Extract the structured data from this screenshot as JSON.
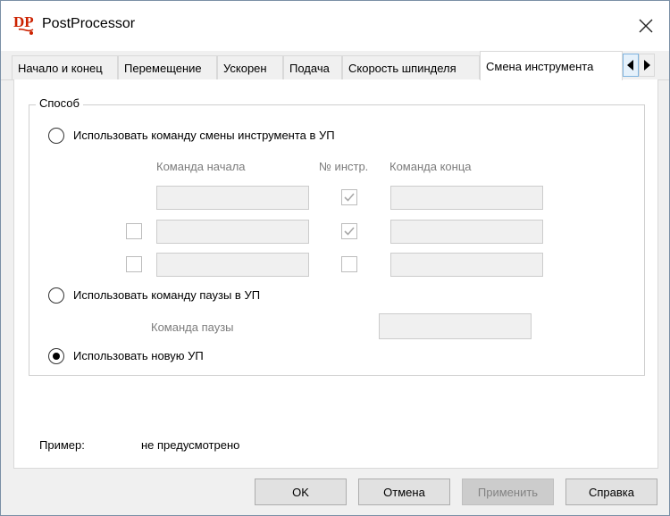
{
  "window": {
    "title": "PostProcessor"
  },
  "tabs": [
    {
      "label": "Начало и конец"
    },
    {
      "label": "Перемещение"
    },
    {
      "label": "Ускорен"
    },
    {
      "label": "Подача"
    },
    {
      "label": "Скорость шпинделя"
    },
    {
      "label": "Смена инструмента",
      "active": true
    }
  ],
  "group": {
    "title": "Способ",
    "option_tool_change": "Использовать команду смены инструмента в УП",
    "option_pause": "Использовать команду паузы в УП",
    "option_new_program": "Использовать новую УП",
    "selected_option": "option_new_program",
    "col_start": "Команда начала",
    "col_tool_no": "№ инстр.",
    "col_end": "Команда конца",
    "rows": [
      {
        "enabled": null,
        "start": "",
        "tool_no": true,
        "end": ""
      },
      {
        "enabled": false,
        "start": "",
        "tool_no": true,
        "end": ""
      },
      {
        "enabled": false,
        "start": "",
        "tool_no": false,
        "end": ""
      }
    ],
    "pause_label": "Команда паузы",
    "pause_value": ""
  },
  "example": {
    "label": "Пример:",
    "value": "не предусмотрено"
  },
  "buttons": {
    "ok": "OK",
    "cancel": "Отмена",
    "apply": "Применить",
    "help": "Справка"
  },
  "colors": {
    "accent_logo": "#cc2200",
    "disabled_field": "#f0f0f0",
    "disabled_text": "#7c7c7c"
  }
}
